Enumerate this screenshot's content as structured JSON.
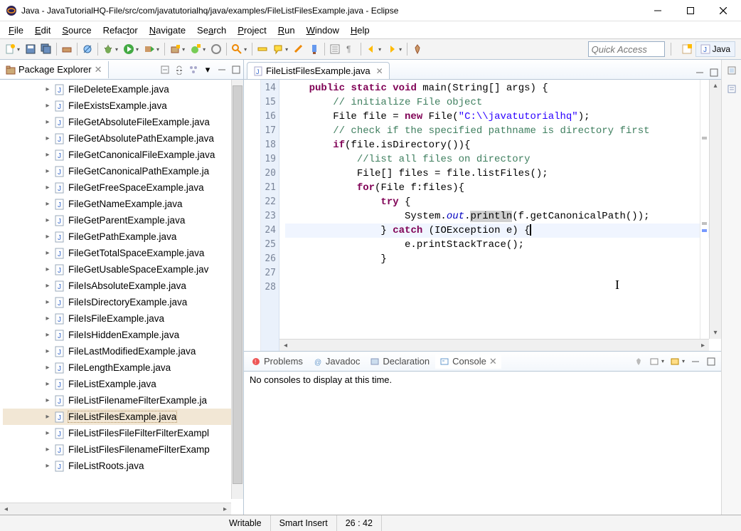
{
  "window": {
    "title": "Java - JavaTutorialHQ-File/src/com/javatutorialhq/java/examples/FileListFilesExample.java - Eclipse"
  },
  "menu": {
    "file": "File",
    "edit": "Edit",
    "source": "Source",
    "refactor": "Refactor",
    "navigate": "Navigate",
    "search": "Search",
    "project": "Project",
    "run": "Run",
    "window": "Window",
    "help": "Help"
  },
  "quick_access_placeholder": "Quick Access",
  "perspective": {
    "java_label": "Java"
  },
  "package_explorer": {
    "title": "Package Explorer",
    "items": [
      "FileDeleteExample.java",
      "FileExistsExample.java",
      "FileGetAbsoluteFileExample.java",
      "FileGetAbsolutePathExample.java",
      "FileGetCanonicalFileExample.java",
      "FileGetCanonicalPathExample.ja",
      "FileGetFreeSpaceExample.java",
      "FileGetNameExample.java",
      "FileGetParentExample.java",
      "FileGetPathExample.java",
      "FileGetTotalSpaceExample.java",
      "FileGetUsableSpaceExample.jav",
      "FileIsAbsoluteExample.java",
      "FileIsDirectoryExample.java",
      "FileIsFileExample.java",
      "FileIsHiddenExample.java",
      "FileLastModifiedExample.java",
      "FileLengthExample.java",
      "FileListExample.java",
      "FileListFilenameFilterExample.ja",
      "FileListFilesExample.java",
      "FileListFilesFileFilterFilterExampl",
      "FileListFilesFilenameFilterExamp",
      "FileListRoots.java"
    ],
    "selected_index": 20
  },
  "editor": {
    "tab_label": "FileListFilesExample.java",
    "first_line": 14,
    "lines": [
      {
        "n": 14,
        "segs": [
          {
            "t": "    "
          },
          {
            "t": "public",
            "c": "kw"
          },
          {
            "t": " "
          },
          {
            "t": "static",
            "c": "kw"
          },
          {
            "t": " "
          },
          {
            "t": "void",
            "c": "kw"
          },
          {
            "t": " main(String[] args) {"
          }
        ]
      },
      {
        "n": 15,
        "segs": [
          {
            "t": ""
          }
        ]
      },
      {
        "n": 16,
        "segs": [
          {
            "t": "        "
          },
          {
            "t": "// initialize File object",
            "c": "cm"
          }
        ]
      },
      {
        "n": 17,
        "segs": [
          {
            "t": "        File file = "
          },
          {
            "t": "new",
            "c": "kw"
          },
          {
            "t": " File("
          },
          {
            "t": "\"C:\\\\javatutorialhq\"",
            "c": "str"
          },
          {
            "t": ");"
          }
        ]
      },
      {
        "n": 18,
        "segs": [
          {
            "t": ""
          }
        ]
      },
      {
        "n": 19,
        "segs": [
          {
            "t": "        "
          },
          {
            "t": "// check if the specified pathname is directory first",
            "c": "cm"
          }
        ]
      },
      {
        "n": 20,
        "segs": [
          {
            "t": "        "
          },
          {
            "t": "if",
            "c": "kw"
          },
          {
            "t": "(file.isDirectory()){"
          }
        ]
      },
      {
        "n": 21,
        "segs": [
          {
            "t": "            "
          },
          {
            "t": "//list all files on directory",
            "c": "cm"
          }
        ]
      },
      {
        "n": 22,
        "segs": [
          {
            "t": "            File[] files = file.listFiles();"
          }
        ]
      },
      {
        "n": 23,
        "segs": [
          {
            "t": "            "
          },
          {
            "t": "for",
            "c": "kw"
          },
          {
            "t": "(File f:files){"
          }
        ]
      },
      {
        "n": 24,
        "segs": [
          {
            "t": "                "
          },
          {
            "t": "try",
            "c": "kw"
          },
          {
            "t": " {"
          }
        ]
      },
      {
        "n": 25,
        "segs": [
          {
            "t": "                    System."
          },
          {
            "t": "out",
            "c": "fld"
          },
          {
            "t": "."
          },
          {
            "t": "println",
            "c": "hl"
          },
          {
            "t": "(f.getCanonicalPath());"
          }
        ]
      },
      {
        "n": 26,
        "cur": true,
        "segs": [
          {
            "t": "                } "
          },
          {
            "t": "catch",
            "c": "kw"
          },
          {
            "t": " (IOException e) {"
          }
        ],
        "caret": true
      },
      {
        "n": 27,
        "segs": [
          {
            "t": "                    e.printStackTrace();"
          }
        ]
      },
      {
        "n": 28,
        "segs": [
          {
            "t": "                }"
          }
        ]
      }
    ]
  },
  "bottom": {
    "tabs": {
      "problems": "Problems",
      "javadoc": "Javadoc",
      "declaration": "Declaration",
      "console": "Console"
    },
    "console_msg": "No consoles to display at this time."
  },
  "status": {
    "writable": "Writable",
    "insert": "Smart Insert",
    "pos": "26 : 42"
  }
}
